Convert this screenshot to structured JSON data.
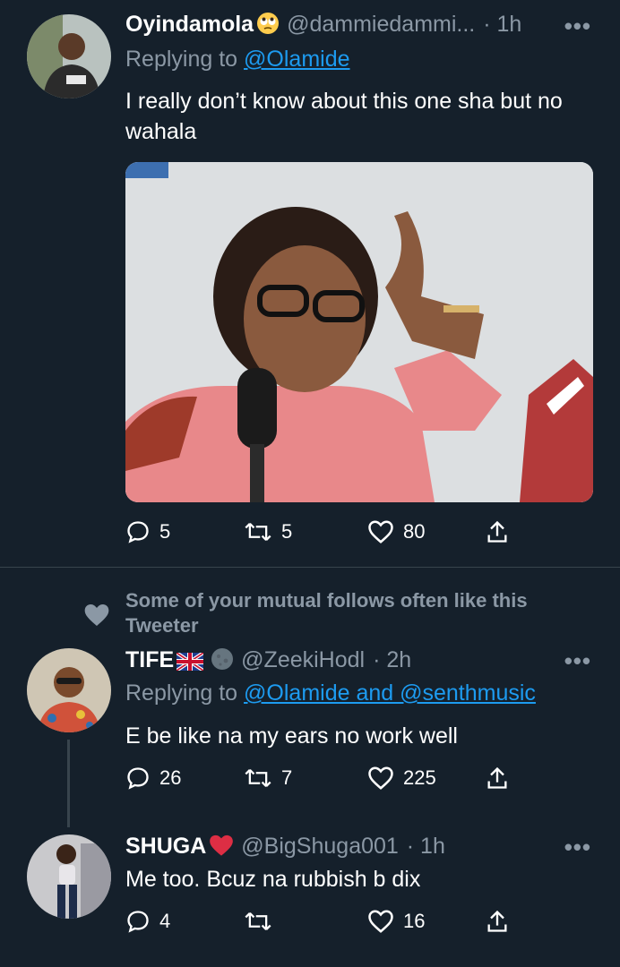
{
  "tweets": [
    {
      "name": "Oyindamola",
      "handle": "@dammiedammi...",
      "time": "· 1h",
      "replying_prefix": "Replying to ",
      "replying_to": "@Olamide",
      "text": "I really don’t know about this one sha but no wahala",
      "replies": "5",
      "retweets": "5",
      "likes": "80"
    },
    {
      "mutual_note": "Some of your mutual follows often like this Tweeter",
      "name": "TIFE",
      "handle": "@ZeekiHodl",
      "time": "· 2h",
      "replying_prefix": "Replying to ",
      "replying_to": "@Olamide and @senthmusic",
      "text": "E be like na my ears no work well",
      "replies": "26",
      "retweets": "7",
      "likes": "225"
    },
    {
      "name": "SHUGA",
      "handle": "@BigShuga001",
      "time": "· 1h",
      "text": "Me too. Bcuz na rubbish b dix",
      "replies": "4",
      "retweets": "",
      "likes": "16"
    }
  ],
  "more_label": "•••",
  "colors": {
    "background": "#15202b",
    "secondary_text": "#8b98a5",
    "link": "#1d9bf0",
    "divider": "#38444d"
  }
}
